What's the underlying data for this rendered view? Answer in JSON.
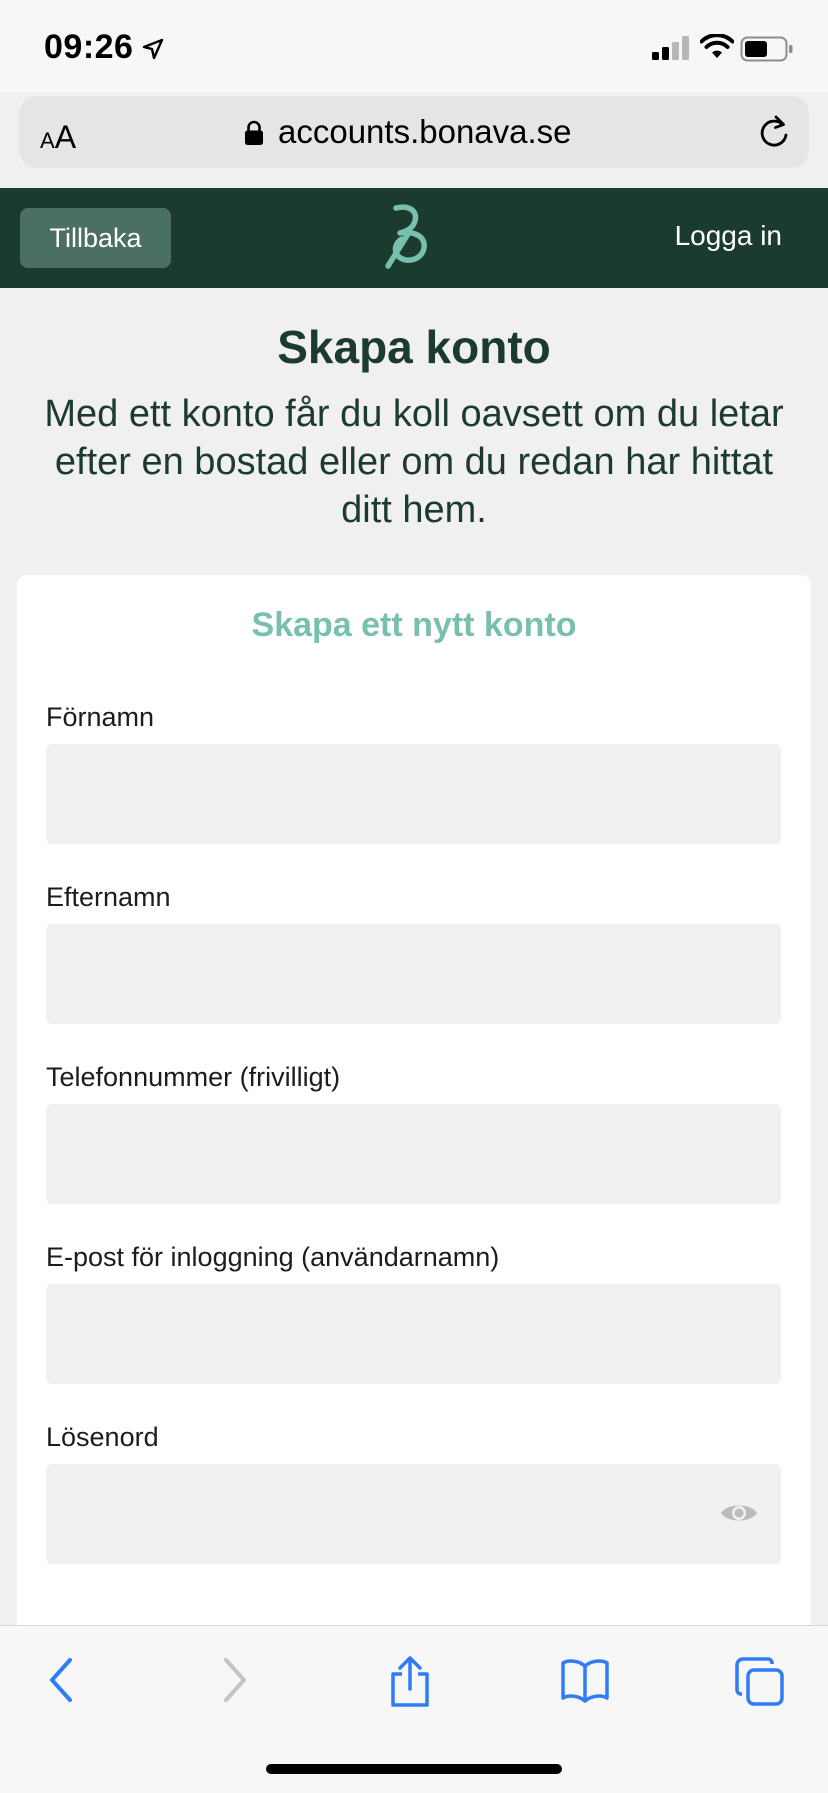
{
  "status_bar": {
    "time": "09:26"
  },
  "browser": {
    "text_size_label": "AA",
    "url": "accounts.bonava.se"
  },
  "header": {
    "back_label": "Tillbaka",
    "login_label": "Logga in"
  },
  "hero": {
    "title": "Skapa konto",
    "subtitle": "Med ett konto får du koll oavsett om du letar efter en bostad eller om du redan har hittat ditt hem."
  },
  "form": {
    "title": "Skapa ett nytt konto",
    "fields": [
      {
        "label": "Förnamn",
        "value": ""
      },
      {
        "label": "Efternamn",
        "value": ""
      },
      {
        "label": "Telefonnummer (frivilligt)",
        "value": ""
      },
      {
        "label": "E-post för inloggning (användarnamn)",
        "value": ""
      },
      {
        "label": "Lösenord",
        "value": ""
      }
    ]
  },
  "colors": {
    "header_bg": "#1b3b2f",
    "back_button_bg": "#4b6f63",
    "accent": "#79bfae",
    "text_dark": "#1c3a30",
    "ios_blue": "#2f7cf6"
  },
  "icons": [
    "location-arrow-icon",
    "signal-icon",
    "wifi-icon",
    "battery-icon",
    "lock-icon",
    "reload-icon",
    "bonava-logo",
    "eye-icon",
    "back-icon",
    "forward-icon",
    "share-icon",
    "bookmarks-icon",
    "tabs-icon"
  ]
}
